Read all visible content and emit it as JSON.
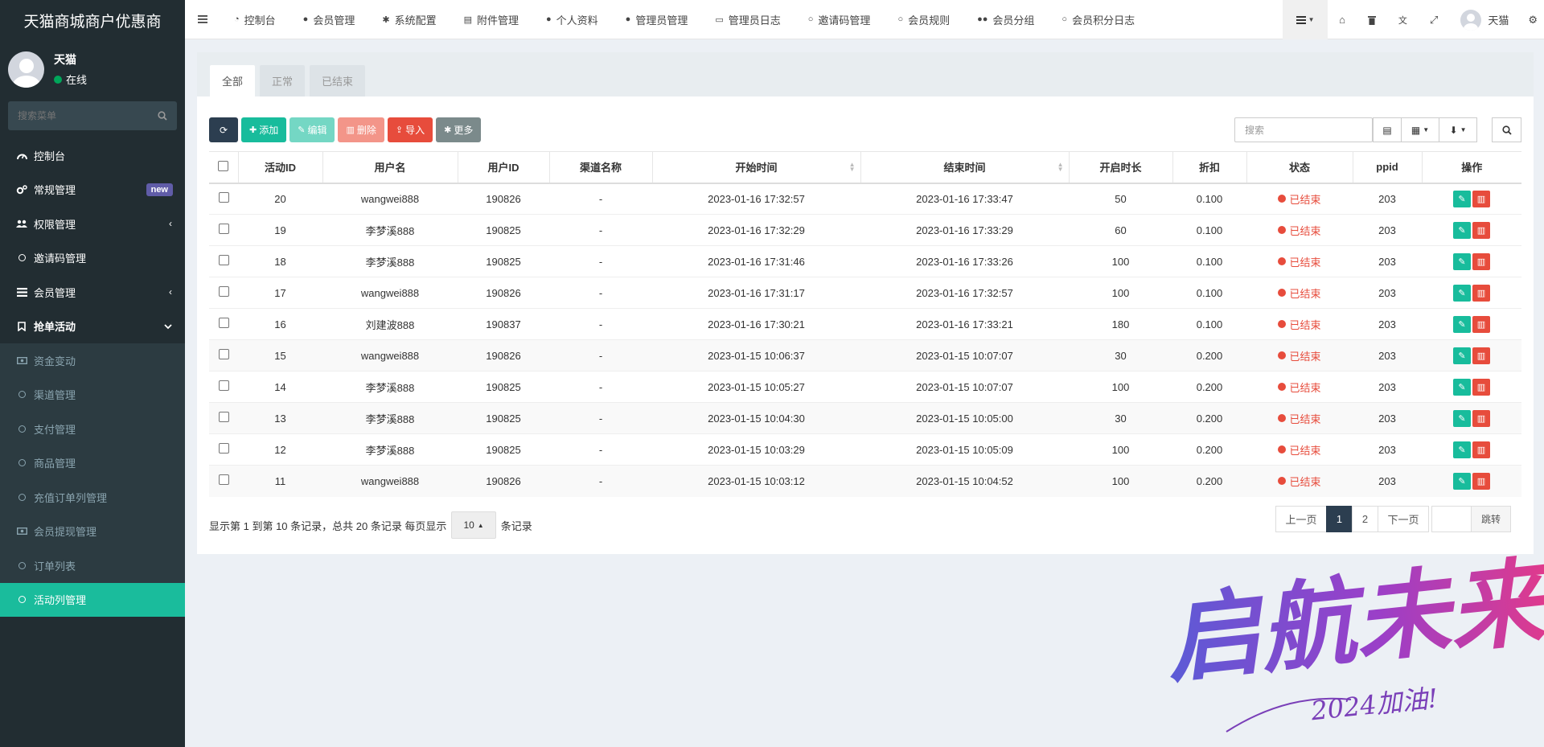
{
  "sidebar": {
    "brand": "天猫商城商户优惠商",
    "user_name": "天猫",
    "user_status": "在线",
    "search_placeholder": "搜索菜单",
    "items": [
      {
        "label": "控制台",
        "icon": "dashboard-icon"
      },
      {
        "label": "常规管理",
        "icon": "cogs-icon",
        "badge": "new"
      },
      {
        "label": "权限管理",
        "icon": "users-icon"
      },
      {
        "label": "邀请码管理",
        "icon": "circle-icon"
      },
      {
        "label": "会员管理",
        "icon": "list-icon"
      },
      {
        "label": "抢单活动",
        "icon": "bookmark-icon"
      }
    ],
    "sub_items": [
      {
        "label": "资金变动",
        "icon": "money-icon"
      },
      {
        "label": "渠道管理",
        "icon": "circle-icon"
      },
      {
        "label": "支付管理",
        "icon": "circle-icon"
      },
      {
        "label": "商品管理",
        "icon": "circle-icon"
      },
      {
        "label": "充值订单列管理",
        "icon": "circle-icon"
      },
      {
        "label": "会员提现管理",
        "icon": "money-icon"
      },
      {
        "label": "订单列表",
        "icon": "circle-icon"
      },
      {
        "label": "活动列管理",
        "icon": "circle-icon"
      }
    ]
  },
  "navbar": {
    "tabs": [
      {
        "label": "控制台",
        "icon": "dashboard-icon"
      },
      {
        "label": "会员管理",
        "icon": "user-icon"
      },
      {
        "label": "系统配置",
        "icon": "cog-icon"
      },
      {
        "label": "附件管理",
        "icon": "file-icon"
      },
      {
        "label": "个人资料",
        "icon": "user-icon"
      },
      {
        "label": "管理员管理",
        "icon": "user-icon"
      },
      {
        "label": "管理员日志",
        "icon": "list-alt-icon"
      },
      {
        "label": "邀请码管理",
        "icon": "circle-icon"
      },
      {
        "label": "会员规则",
        "icon": "circle-icon"
      },
      {
        "label": "会员分组",
        "icon": "users-icon"
      },
      {
        "label": "会员积分日志",
        "icon": "circle-icon"
      }
    ],
    "user_name": "天猫"
  },
  "panel": {
    "tabs": [
      "全部",
      "正常",
      "已结束"
    ],
    "toolbar": {
      "add": "添加",
      "edit": "编辑",
      "delete": "删除",
      "import": "导入",
      "more": "更多"
    },
    "search_placeholder": "搜索"
  },
  "table": {
    "columns": [
      "活动ID",
      "用户名",
      "用户ID",
      "渠道名称",
      "开始时间",
      "结束时间",
      "开启时长",
      "折扣",
      "状态",
      "ppid",
      "操作"
    ],
    "rows": [
      {
        "id": "20",
        "username": "wangwei888",
        "uid": "190826",
        "channel": "-",
        "start": "2023-01-16 17:32:57",
        "end": "2023-01-16 17:33:47",
        "duration": "50",
        "discount": "0.100",
        "status": "已结束",
        "ppid": "203"
      },
      {
        "id": "19",
        "username": "李梦溪888",
        "uid": "190825",
        "channel": "-",
        "start": "2023-01-16 17:32:29",
        "end": "2023-01-16 17:33:29",
        "duration": "60",
        "discount": "0.100",
        "status": "已结束",
        "ppid": "203"
      },
      {
        "id": "18",
        "username": "李梦溪888",
        "uid": "190825",
        "channel": "-",
        "start": "2023-01-16 17:31:46",
        "end": "2023-01-16 17:33:26",
        "duration": "100",
        "discount": "0.100",
        "status": "已结束",
        "ppid": "203"
      },
      {
        "id": "17",
        "username": "wangwei888",
        "uid": "190826",
        "channel": "-",
        "start": "2023-01-16 17:31:17",
        "end": "2023-01-16 17:32:57",
        "duration": "100",
        "discount": "0.100",
        "status": "已结束",
        "ppid": "203"
      },
      {
        "id": "16",
        "username": "刘建波888",
        "uid": "190837",
        "channel": "-",
        "start": "2023-01-16 17:30:21",
        "end": "2023-01-16 17:33:21",
        "duration": "180",
        "discount": "0.100",
        "status": "已结束",
        "ppid": "203"
      },
      {
        "id": "15",
        "username": "wangwei888",
        "uid": "190826",
        "channel": "-",
        "start": "2023-01-15 10:06:37",
        "end": "2023-01-15 10:07:07",
        "duration": "30",
        "discount": "0.200",
        "status": "已结束",
        "ppid": "203"
      },
      {
        "id": "14",
        "username": "李梦溪888",
        "uid": "190825",
        "channel": "-",
        "start": "2023-01-15 10:05:27",
        "end": "2023-01-15 10:07:07",
        "duration": "100",
        "discount": "0.200",
        "status": "已结束",
        "ppid": "203"
      },
      {
        "id": "13",
        "username": "李梦溪888",
        "uid": "190825",
        "channel": "-",
        "start": "2023-01-15 10:04:30",
        "end": "2023-01-15 10:05:00",
        "duration": "30",
        "discount": "0.200",
        "status": "已结束",
        "ppid": "203"
      },
      {
        "id": "12",
        "username": "李梦溪888",
        "uid": "190825",
        "channel": "-",
        "start": "2023-01-15 10:03:29",
        "end": "2023-01-15 10:05:09",
        "duration": "100",
        "discount": "0.200",
        "status": "已结束",
        "ppid": "203"
      },
      {
        "id": "11",
        "username": "wangwei888",
        "uid": "190826",
        "channel": "-",
        "start": "2023-01-15 10:03:12",
        "end": "2023-01-15 10:04:52",
        "duration": "100",
        "discount": "0.200",
        "status": "已结束",
        "ppid": "203"
      }
    ]
  },
  "pagination": {
    "info_prefix": "显示第 1 到第 10 条记录，总共 20 条记录 每页显示",
    "page_size": "10",
    "info_suffix": "条记录",
    "prev": "上一页",
    "pages": [
      "1",
      "2"
    ],
    "next": "下一页",
    "jump": "跳转"
  },
  "watermark": {
    "main_text": "启航未来",
    "sub_text": "2024加油!"
  },
  "colors": {
    "sidebar_bg": "#222d32",
    "accent": "#18bc9c",
    "danger": "#e74c3c",
    "dark": "#2c3e50"
  }
}
